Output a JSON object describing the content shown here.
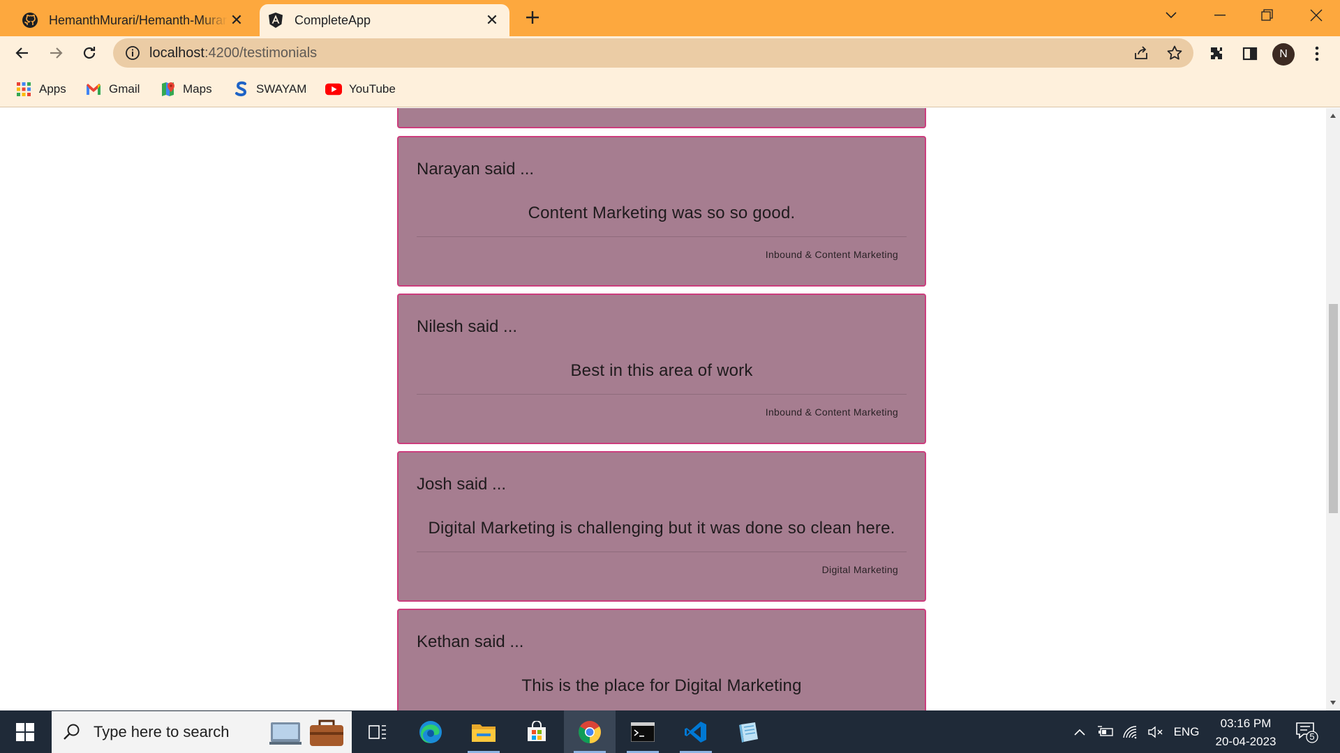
{
  "browser": {
    "tabs": [
      {
        "title": "HemanthMurari/Hemanth-Murari",
        "favicon": "github-icon",
        "active": false
      },
      {
        "title": "CompleteApp",
        "favicon": "angular-icon",
        "active": true
      }
    ],
    "address": {
      "host": "localhost",
      "path": ":4200/testimonials"
    },
    "profile_initial": "N",
    "bookmarks": [
      {
        "label": "Apps",
        "icon": "apps-grid-icon"
      },
      {
        "label": "Gmail",
        "icon": "gmail-icon"
      },
      {
        "label": "Maps",
        "icon": "maps-icon"
      },
      {
        "label": "SWAYAM",
        "icon": "swayam-icon"
      },
      {
        "label": "YouTube",
        "icon": "youtube-icon"
      }
    ]
  },
  "testimonials": [
    {
      "author": "Narayan said ...",
      "quote": "Content Marketing was so so good.",
      "category": "Inbound & Content Marketing"
    },
    {
      "author": "Nilesh said ...",
      "quote": "Best in this area of work",
      "category": "Inbound & Content Marketing"
    },
    {
      "author": "Josh said ...",
      "quote": "Digital Marketing is challenging but it was done so clean here.",
      "category": "Digital Marketing"
    },
    {
      "author": "Kethan said ...",
      "quote": "This is the place for Digital Marketing",
      "category": ""
    }
  ],
  "taskbar": {
    "search_placeholder": "Type here to search",
    "apps": [
      "task-view-icon",
      "edge-icon",
      "file-explorer-icon",
      "microsoft-store-icon",
      "chrome-icon",
      "terminal-icon",
      "vscode-icon",
      "notepad-icon"
    ],
    "active_app": "chrome-icon",
    "language": "ENG",
    "time": "03:16 PM",
    "date": "20-04-2023",
    "notification_count": "5"
  },
  "colors": {
    "tabbar": "#fda83e",
    "toolbar": "#fef0dc",
    "card_bg": "#a67d90",
    "card_border": "#cc3d7d",
    "taskbar": "#1f2a38"
  }
}
